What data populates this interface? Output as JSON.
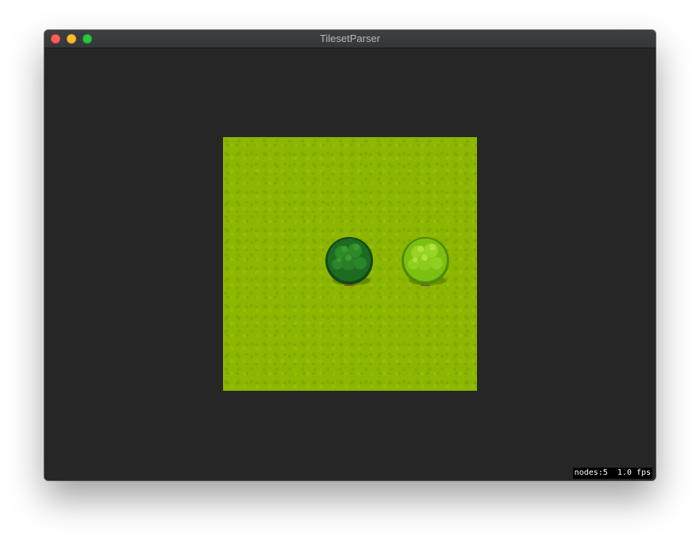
{
  "window": {
    "title": "TilesetParser"
  },
  "scene": {
    "ground": "grass",
    "trees": [
      {
        "name": "dark-green-tree",
        "canopy_color": "#1e6b22",
        "highlight_color": "#3a9a2c"
      },
      {
        "name": "light-green-tree",
        "canopy_color": "#7cc010",
        "highlight_color": "#b4e040"
      }
    ]
  },
  "status": {
    "text": "nodes:5  1.0 fps"
  },
  "colors": {
    "background": "#262626",
    "grass": "#8db600",
    "close": "#fe5f57",
    "minimize": "#febc2e",
    "maximize": "#28c840"
  }
}
